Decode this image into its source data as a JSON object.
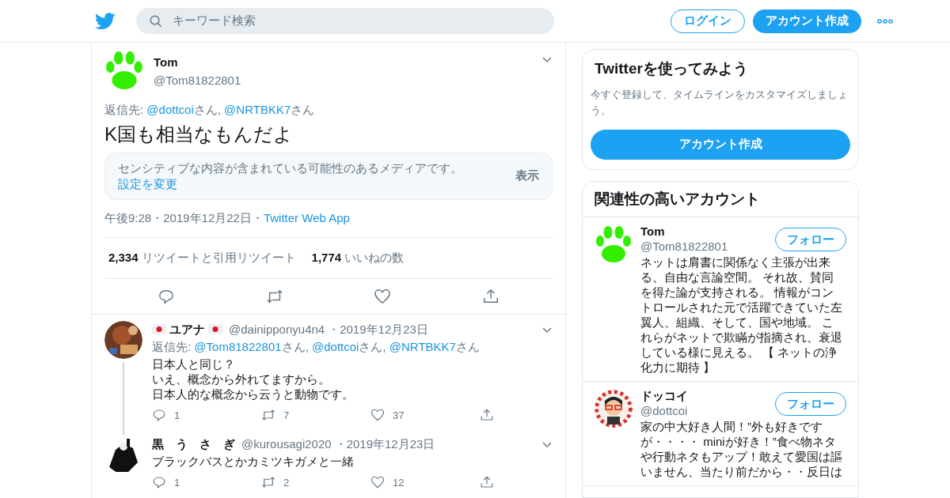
{
  "header": {
    "search_placeholder": "キーワード検索",
    "login": "ログイン",
    "signup": "アカウント作成"
  },
  "tweet": {
    "name": "Tom",
    "handle": "@Tom81822801",
    "reply_to": {
      "label": "返信先: ",
      "mentions": [
        {
          "handle": "@dottcoi",
          "suffix": "さん, "
        },
        {
          "handle": "@NRTBKK7",
          "suffix": "さん"
        }
      ]
    },
    "text": "K国も相当なもんだよ",
    "sensitive": {
      "text": "センシティブな内容が含まれている可能性のあるメディアです。",
      "link": "設定を変更",
      "action": "表示"
    },
    "time": "午後9:28・2019年12月22日・",
    "source": "Twitter Web App",
    "stats": [
      {
        "count": "2,334",
        "label": "リツイートと引用リツイート"
      },
      {
        "count": "1,774",
        "label": "いいねの数"
      }
    ]
  },
  "replies": [
    {
      "name": "ユアナ",
      "flags": true,
      "handle": "@dainipponyu4n4",
      "date": "・2019年12月23日",
      "reply_to": {
        "label": "返信先: ",
        "mentions": [
          {
            "handle": "@Tom81822801",
            "suffix": "さん, "
          },
          {
            "handle": "@dottcoi",
            "suffix": "さん, "
          },
          {
            "handle": "@NRTBKK7",
            "suffix": "さん"
          }
        ]
      },
      "lines": [
        "日本人と同じ？",
        "いえ、概念から外れてますから。",
        "日本人的な概念から云うと動物です。"
      ],
      "counts": [
        "1",
        "7",
        "37"
      ],
      "thread": true
    },
    {
      "name": "黒　う　さ　ぎ",
      "flags": false,
      "handle": "@kurousagi2020",
      "date": "・2019年12月23日",
      "lines": [
        "ブラックバスとかカミツキガメと一緒"
      ],
      "counts": [
        "1",
        "2",
        "12"
      ],
      "thread": false
    }
  ],
  "signup_card": {
    "title": "Twitterを使ってみよう",
    "text": "今すぐ登録して、タイムラインをカスタマイズしましょう。",
    "button": "アカウント作成"
  },
  "related": {
    "title": "関連性の高いアカウント",
    "accounts": [
      {
        "kind": "paw",
        "name": "Tom",
        "handle": "@Tom81822801",
        "follow": "フォロー",
        "bio": "ネットは肩書に関係なく主張が出来る、自由な言論空間。 それ故、賛同を得た論が支持される。 情報がコントロールされた元で活躍できていた左翼人、組織、そして、国や地域。 これらがネットで欺瞞が指摘され、衰退している様に見える。 【 ネットの浄化力に期待 】"
      },
      {
        "kind": "picture",
        "name": "ドッコイ",
        "handle": "@dottcoi",
        "follow": "フォロー",
        "bio": "家の中大好き人間！”外も好きですが・・・・ miniが好き！”食べ物ネタや行動ネタもアップ！敢えて愛国は謳いません、当たり前だから・・反日は"
      }
    ]
  }
}
